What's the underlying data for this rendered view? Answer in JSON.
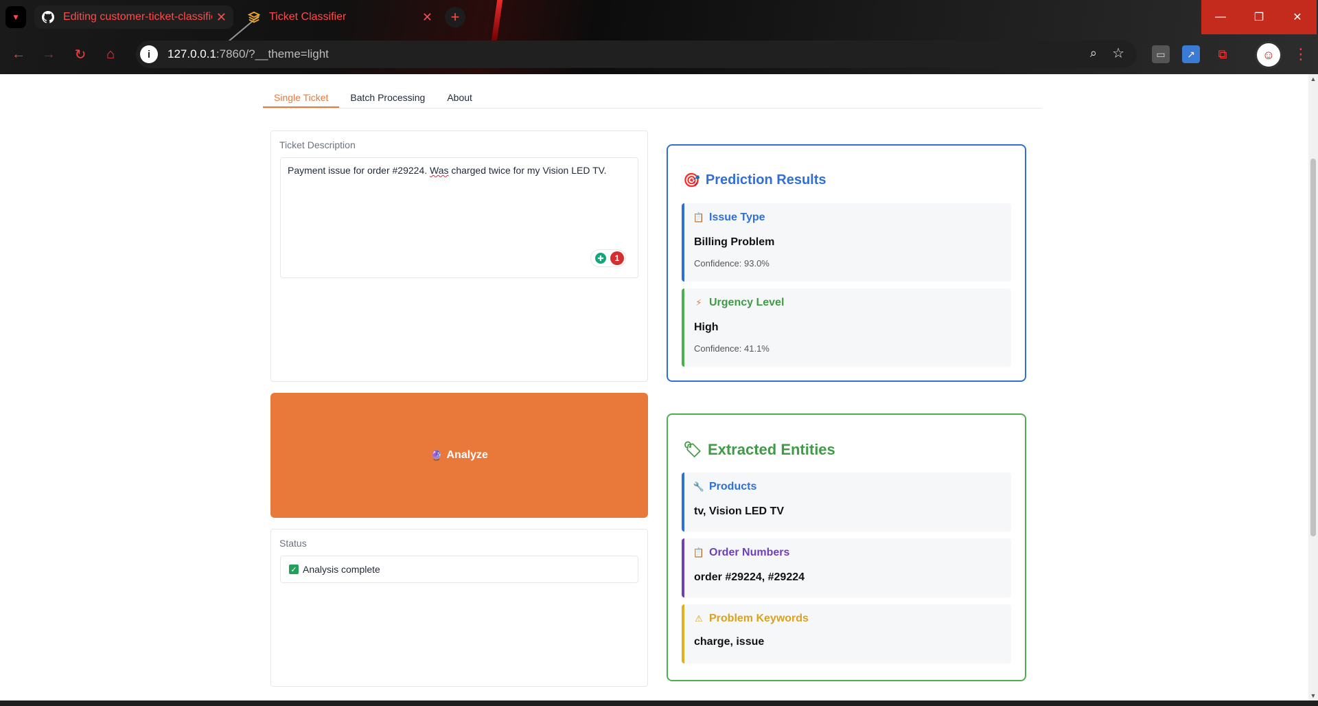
{
  "browser": {
    "tabs": [
      {
        "title": "Editing customer-ticket-classifie",
        "icon": "github-icon"
      },
      {
        "title": "Ticket Classifier",
        "icon": "layers-icon"
      }
    ],
    "url_host": "127.0.0.1",
    "url_rest": ":7860/?__theme=light"
  },
  "app": {
    "tabs": [
      "Single Ticket",
      "Batch Processing",
      "About"
    ],
    "active_tab": "Single Ticket",
    "description_label": "Ticket Description",
    "description_before": "Payment issue for order #29224. ",
    "description_misspelled": "Was",
    "description_after": " charged twice for my Vision LED TV.",
    "grammarly_count": "1",
    "analyze_label": "Analyze",
    "status_label": "Status",
    "status_value": "Analysis complete"
  },
  "prediction": {
    "title": "Prediction Results",
    "issue_type_label": "Issue Type",
    "issue_type_value": "Billing Problem",
    "issue_type_confidence": "Confidence: 93.0%",
    "urgency_label": "Urgency Level",
    "urgency_value": "High",
    "urgency_confidence": "Confidence: 41.1%"
  },
  "entities": {
    "title": "Extracted Entities",
    "products_label": "Products",
    "products_value": "tv, Vision LED TV",
    "orders_label": "Order Numbers",
    "orders_value": "order #29224, #29224",
    "keywords_label": "Problem Keywords",
    "keywords_value": "charge, issue"
  },
  "colors": {
    "accent_orange": "#e8793a",
    "blue": "#2f6fd6",
    "green": "#4caf50",
    "purple": "#6f3fb8",
    "yellow": "#e0b020"
  }
}
